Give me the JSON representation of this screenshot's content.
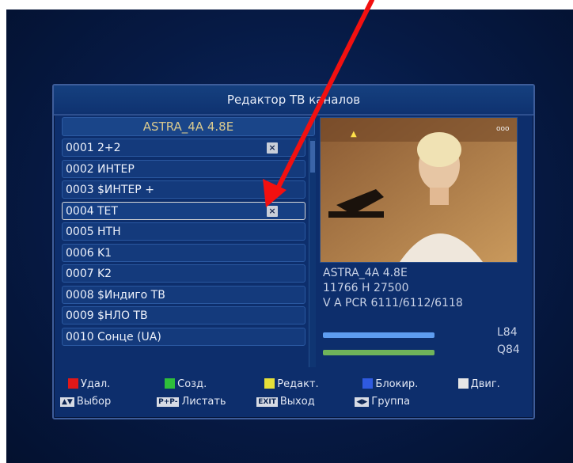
{
  "title": "Редактор ТВ каналов",
  "satellite": "ASTRA_4A 4.8E",
  "channels": [
    {
      "num": "0001",
      "name": "2+2",
      "marked": true
    },
    {
      "num": "0002",
      "name": "ИНТЕР",
      "marked": false
    },
    {
      "num": "0003",
      "name": "$ИНТЕР +",
      "marked": false
    },
    {
      "num": "0004",
      "name": "TET",
      "marked": true
    },
    {
      "num": "0005",
      "name": "НТН",
      "marked": false
    },
    {
      "num": "0006",
      "name": "K1",
      "marked": false
    },
    {
      "num": "0007",
      "name": "K2",
      "marked": false
    },
    {
      "num": "0008",
      "name": "$Индиго ТВ",
      "marked": false
    },
    {
      "num": "0009",
      "name": "$НЛО ТВ",
      "marked": false
    },
    {
      "num": "0010",
      "name": "Сонце (UA)",
      "marked": false
    }
  ],
  "selected_index": 3,
  "info": {
    "sat": "ASTRA_4A 4.8E",
    "freq": "11766 H 27500",
    "pids": "V A PCR 6111/6112/6118"
  },
  "signal": {
    "level_label": "L84",
    "level_value": 84,
    "quality_label": "Q84",
    "quality_value": 84
  },
  "legend": {
    "delete": "Удал.",
    "create": "Созд.",
    "edit": "Редакт.",
    "block": "Блокир.",
    "move": "Двиг.",
    "select": "Выбор",
    "page": "Листать",
    "exit": "Выход",
    "group": "Группа",
    "key_select": "▲▼",
    "key_page": "P+P-",
    "key_exit": "EXIT",
    "key_group": "◀▶"
  },
  "preview_icon": "ooo",
  "colors": {
    "red": "#e01818",
    "green": "#2fbf3a",
    "yellow": "#e6e039",
    "blue": "#2f5ae0",
    "white": "#e6e6e6",
    "level_bar": "#5e9df0",
    "quality_bar": "#6fb35a",
    "annotation_arrow": "#f21010"
  }
}
